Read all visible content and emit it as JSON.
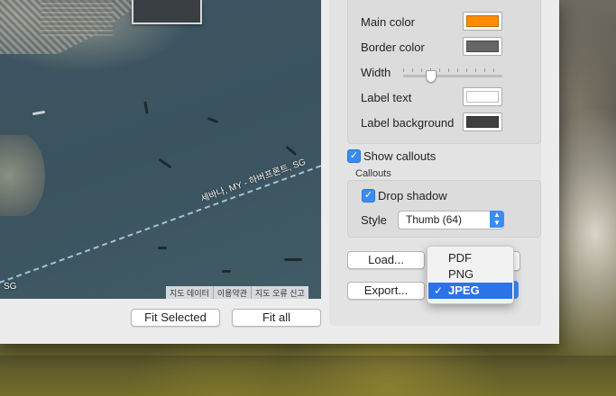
{
  "map": {
    "boundary_label": "세바나, MY - 하버프론트, SG",
    "edge_label": "SG",
    "attribution": [
      "지도 데이터",
      "이용약관",
      "지도 오류 신고"
    ]
  },
  "buttons": {
    "fit_selected": "Fit Selected",
    "fit_all": "Fit all",
    "load": "Load...",
    "export": "Export..."
  },
  "style_box": {
    "main_color": {
      "label": "Main color",
      "color": "#ff8c00"
    },
    "border_color": {
      "label": "Border color",
      "color": "#666666"
    },
    "width": {
      "label": "Width",
      "value": 0.25
    },
    "label_text": {
      "label": "Label text",
      "color": "#ffffff"
    },
    "label_background": {
      "label": "Label background",
      "color": "#404040"
    }
  },
  "show_callouts": {
    "label": "Show callouts",
    "checked": true
  },
  "callouts": {
    "header": "Callouts",
    "drop_shadow": {
      "label": "Drop shadow",
      "checked": true
    },
    "style_label": "Style",
    "style_value": "Thumb (64)"
  },
  "export_menu": {
    "options": [
      "PDF",
      "PNG",
      "JPEG"
    ],
    "selected": "JPEG"
  },
  "accent": "#3b8cf2"
}
